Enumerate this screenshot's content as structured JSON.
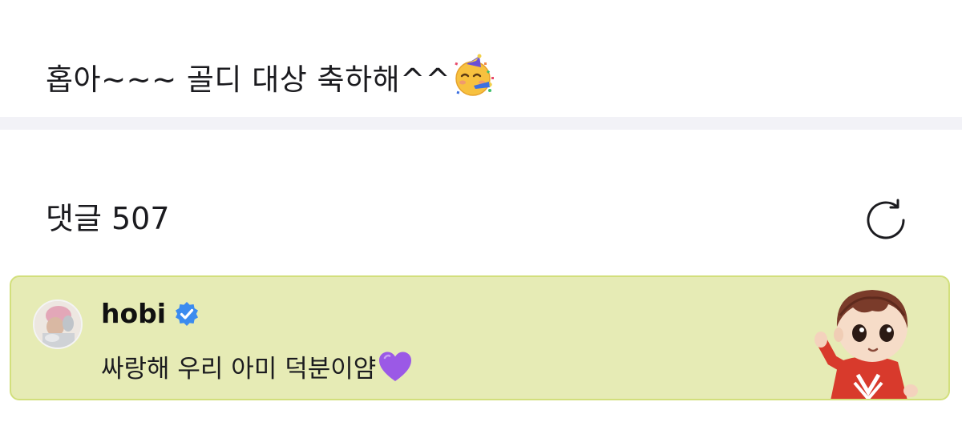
{
  "post": {
    "text": "홉아~~~ 골디 대상 축하해^^",
    "emoji": "partying-face-icon"
  },
  "comments": {
    "title": "댓글 507",
    "refresh_icon": "refresh-icon"
  },
  "pinned_comment": {
    "author": "hobi",
    "verified_icon": "verified-badge-icon",
    "text": "싸랑해 우리 아미 덕분이얌",
    "emoji": "purple-heart-icon",
    "sticker": "tinytan-character-sticker",
    "card_color": "#e6ebb5",
    "border_color": "#d2df7c"
  },
  "colors": {
    "divider": "#f2f2f7",
    "verified": "#3b8bef",
    "heart": "#9b59e6"
  }
}
